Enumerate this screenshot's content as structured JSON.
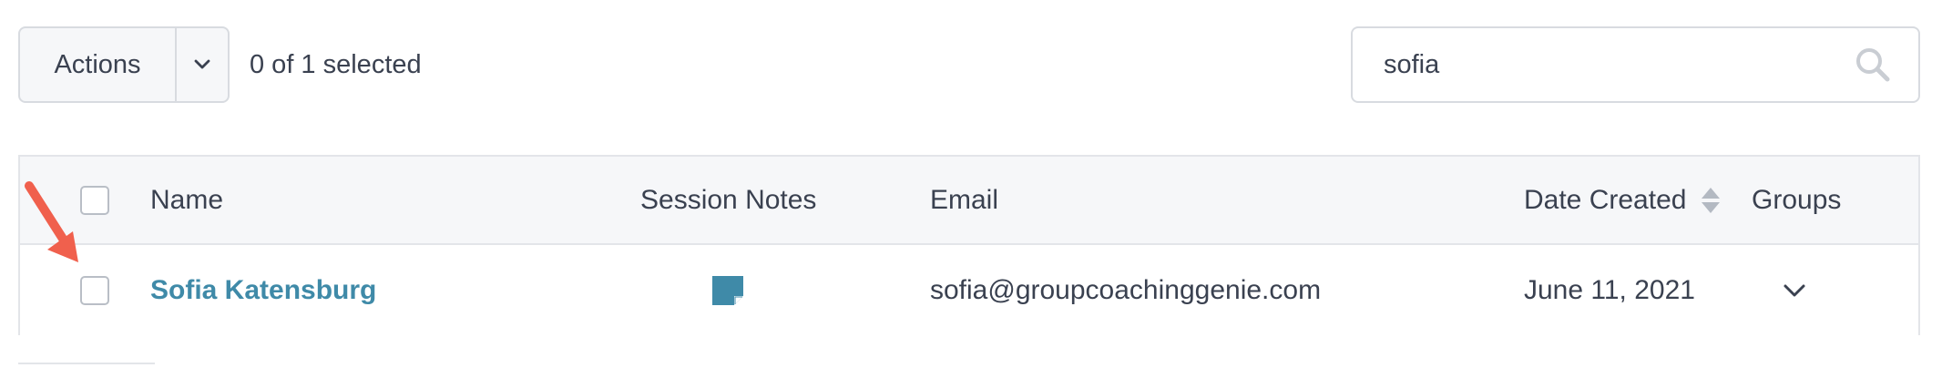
{
  "toolbar": {
    "actions_label": "Actions",
    "actions_caret_icon": "chevron-down-icon",
    "selected_text": "0 of 1 selected"
  },
  "search": {
    "value": "sofia",
    "icon": "search-icon"
  },
  "table": {
    "columns": {
      "name": "Name",
      "session_notes": "Session Notes",
      "email": "Email",
      "date_created": "Date Created",
      "groups": "Groups"
    },
    "rows": [
      {
        "name": "Sofia Katensburg",
        "session_notes_icon": "sticky-note-icon",
        "email": "sofia@groupcoachinggenie.com",
        "date_created": "June 11, 2021",
        "groups_icon": "chevron-down-icon"
      }
    ]
  },
  "colors": {
    "link": "#3f8aa8",
    "note_icon": "#3f8aa8",
    "annotation_arrow": "#f0604d",
    "header_bg": "#f6f7f9",
    "border": "#e3e5e9"
  }
}
